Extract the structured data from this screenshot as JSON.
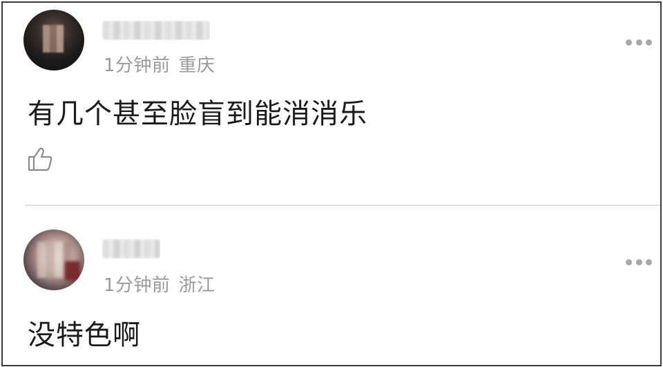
{
  "comments": [
    {
      "time": "1分钟前",
      "location": "重庆",
      "text": "有几个甚至脸盲到能消消乐"
    },
    {
      "time": "1分钟前",
      "location": "浙江",
      "text": "没特色啊"
    }
  ],
  "icons": {
    "like": "thumbs-up-icon",
    "more": "more-dots-icon"
  },
  "colors": {
    "meta_text": "#9a9a9a",
    "body_text": "#1a1a1a",
    "divider": "#e2e2e2",
    "frame_border": "#3a3a3a"
  }
}
